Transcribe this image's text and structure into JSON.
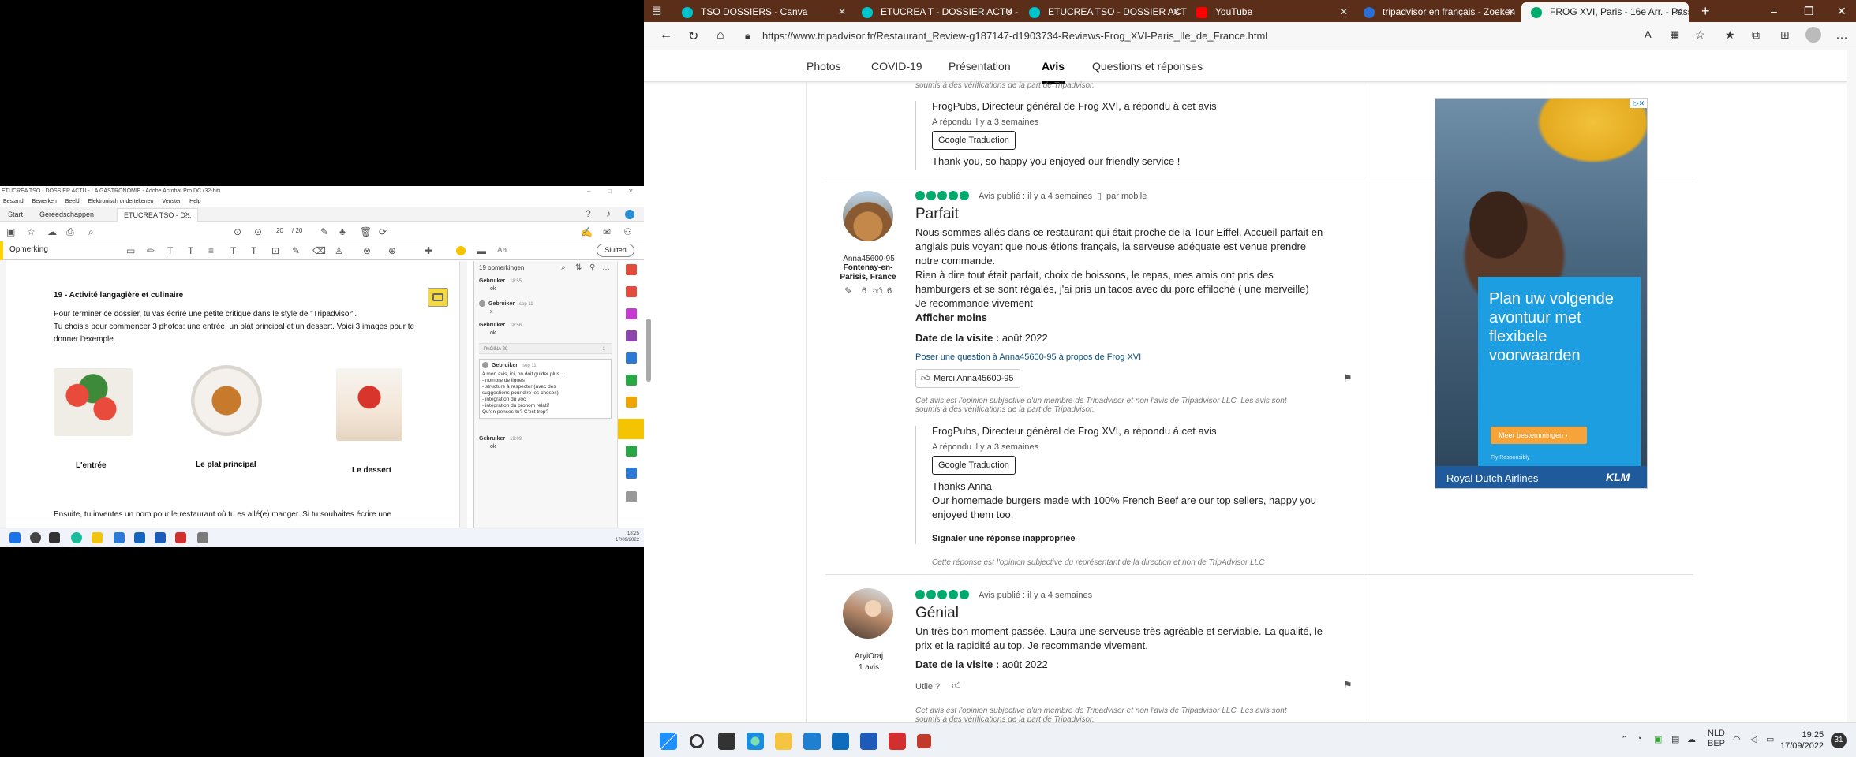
{
  "acrobat": {
    "title": "ETUCREA TSO - DOSSIER ACTU - LA GASTRONOMIE - Adobe Acrobat Pro DC (32-bit)",
    "menu": [
      "Bestand",
      "Bewerken",
      "Beeld",
      "Elektronisch ondertekenen",
      "Venster",
      "Help"
    ],
    "tabs": [
      "Start",
      "Gereedschappen",
      "ETUCREA TSO - D..."
    ],
    "page_current": "20",
    "page_total": "/ 20",
    "tool_label": "Opmerking",
    "text_tool": "Aa",
    "close_label": "Sluiten",
    "doc": {
      "heading": "19 - Activité langagière et culinaire",
      "para1": "Pour terminer ce dossier, tu vas écrire une petite critique dans le style de \"Tripadvisor\".",
      "para2": "Tu choisis pour commencer 3 photos: une entrée, un plat principal et un dessert.  Voici 3 images pour te donner l'exemple.",
      "caption1": "L'entrée",
      "caption2": "Le plat principal",
      "caption3": "Le dessert",
      "para3": "Ensuite, tu inventes un nom pour le restaurant où tu es allé(e) manger.  Si tu souhaites écrire une"
    },
    "panel": {
      "header": "19 opmerkingen",
      "comments": [
        {
          "user": "Gebruiker",
          "time": "18:55",
          "body": "ok"
        },
        {
          "user": "Gebruiker",
          "time": "sep 11",
          "body": "x"
        },
        {
          "user": "Gebruiker",
          "time": "18:56",
          "body": "ok"
        }
      ],
      "page_label": "PAGINA 20",
      "page_count": "1",
      "comment4_user": "Gebruiker",
      "comment4_time": "sep 11",
      "comment4_body": [
        "à mon avis, ici, on doit guider plus...",
        "- nombre de lignes",
        "- structure à respecter (avec des",
        "suggestions pour dire les choses)",
        "- intégration du voc",
        "- intégration du pronom relatif",
        "Qu'en penses-tu? C'est trop?"
      ],
      "comment5_user": "Gebruiker",
      "comment5_time": "19:09",
      "comment5_body": "ok"
    }
  },
  "taskbar_left": {
    "time": "18:25",
    "date": "17/09/2022"
  },
  "edge": {
    "tabs": [
      {
        "label": "TSO DOSSIERS - Canva",
        "color": "#00c4cc"
      },
      {
        "label": "ETUCREA T - DOSSIER ACTU - In",
        "color": "#00c4cc"
      },
      {
        "label": "ETUCREA TSO - DOSSIER ACTU",
        "color": "#00c4cc"
      },
      {
        "label": "YouTube",
        "color": "#ff0000"
      },
      {
        "label": "tripadvisor en français - Zoeken",
        "color": "#2a6fd6"
      },
      {
        "label": "FROG XVI, Paris - 16e Arr. - Pass",
        "color": "#00aa6c"
      }
    ],
    "url": "https://www.tripadvisor.fr/Restaurant_Review-g187147-d1903734-Reviews-Frog_XVI-Paris_Ile_de_France.html"
  },
  "page": {
    "subnav": [
      "Photos",
      "COVID-19",
      "Présentation",
      "Avis",
      "Questions et réponses"
    ],
    "top_disclaimer": "soumis à des vérifications de la part de Tripadvisor.",
    "reply1": {
      "author": "FrogPubs, Directeur général de Frog XVI, a répondu à cet avis",
      "when": "A répondu il y a 3 semaines",
      "translate": "Google Traduction",
      "body": "Thank you, so happy you enjoyed our friendly service !"
    },
    "review1": {
      "username": "Anna45600-95",
      "location": "Fontenay-en-Parisis, France",
      "contrib": "6",
      "votes": "6",
      "posted": "Avis publié : il y a 4 semaines",
      "mobile": "par mobile",
      "title": "Parfait",
      "body": [
        "Nous sommes allés dans ce restaurant qui était proche de la Tour Eiffel. Accueil parfait en",
        "anglais puis voyant que nous étions français, la serveuse adéquate est venue prendre",
        "notre commande.",
        "Rien à dire tout était parfait, choix de boissons, le repas, mes amis ont pris des",
        "hamburgers et se sont régalés, j'ai pris un tacos avec du porc effiloché ( une merveille)",
        "Je recommande vivement"
      ],
      "less": "Afficher moins",
      "visit_label": "Date de la visite :",
      "visit": "août 2022",
      "ask": "Poser une question à Anna45600-95 à propos de Frog XVI",
      "thanks": "Merci Anna45600-95",
      "disclaimer": [
        "Cet avis est l'opinion subjective d'un membre de Tripadvisor et non l'avis de Tripadvisor LLC. Les avis sont",
        "soumis à des vérifications de la part de Tripadvisor."
      ]
    },
    "reply2": {
      "author": "FrogPubs, Directeur général de Frog XVI, a répondu à cet avis",
      "when": "A répondu il y a 3 semaines",
      "translate": "Google Traduction",
      "body": [
        "Thanks Anna",
        "Our homemade burgers made with 100% French Beef are our top sellers, happy you",
        "enjoyed them too."
      ],
      "report": "Signaler une réponse inappropriée",
      "disclaimer": "Cette réponse est l'opinion subjective du représentant de la direction et non de TripAdvisor LLC"
    },
    "review2": {
      "username": "AryiOraj",
      "count": "1 avis",
      "posted": "Avis publié : il y a 4 semaines",
      "title": "Génial",
      "body": [
        "Un très bon moment passée. Laura une serveuse très agréable et serviable. La qualité, le",
        "prix et la rapidité au top. Je recommande vivement."
      ],
      "visit_label": "Date de la visite :",
      "visit": "août 2022",
      "useful": "Utile ?",
      "disclaimer": [
        "Cet avis est l'opinion subjective d'un membre de Tripadvisor et non l'avis de Tripadvisor LLC. Les avis sont",
        "soumis à des vérifications de la part de Tripadvisor."
      ]
    },
    "ad": {
      "headline": [
        "Plan uw volgende",
        "avontuur met",
        "flexibele",
        "voorwaarden"
      ],
      "cta": "Meer bestemmingen",
      "resp": "Fly Responsibly",
      "airline": "Royal Dutch Airlines",
      "brand": "KLM"
    }
  },
  "taskbar_right": {
    "lang1": "NLD",
    "lang2": "BEP",
    "time": "19:25",
    "date": "17/09/2022",
    "badge": "31"
  }
}
